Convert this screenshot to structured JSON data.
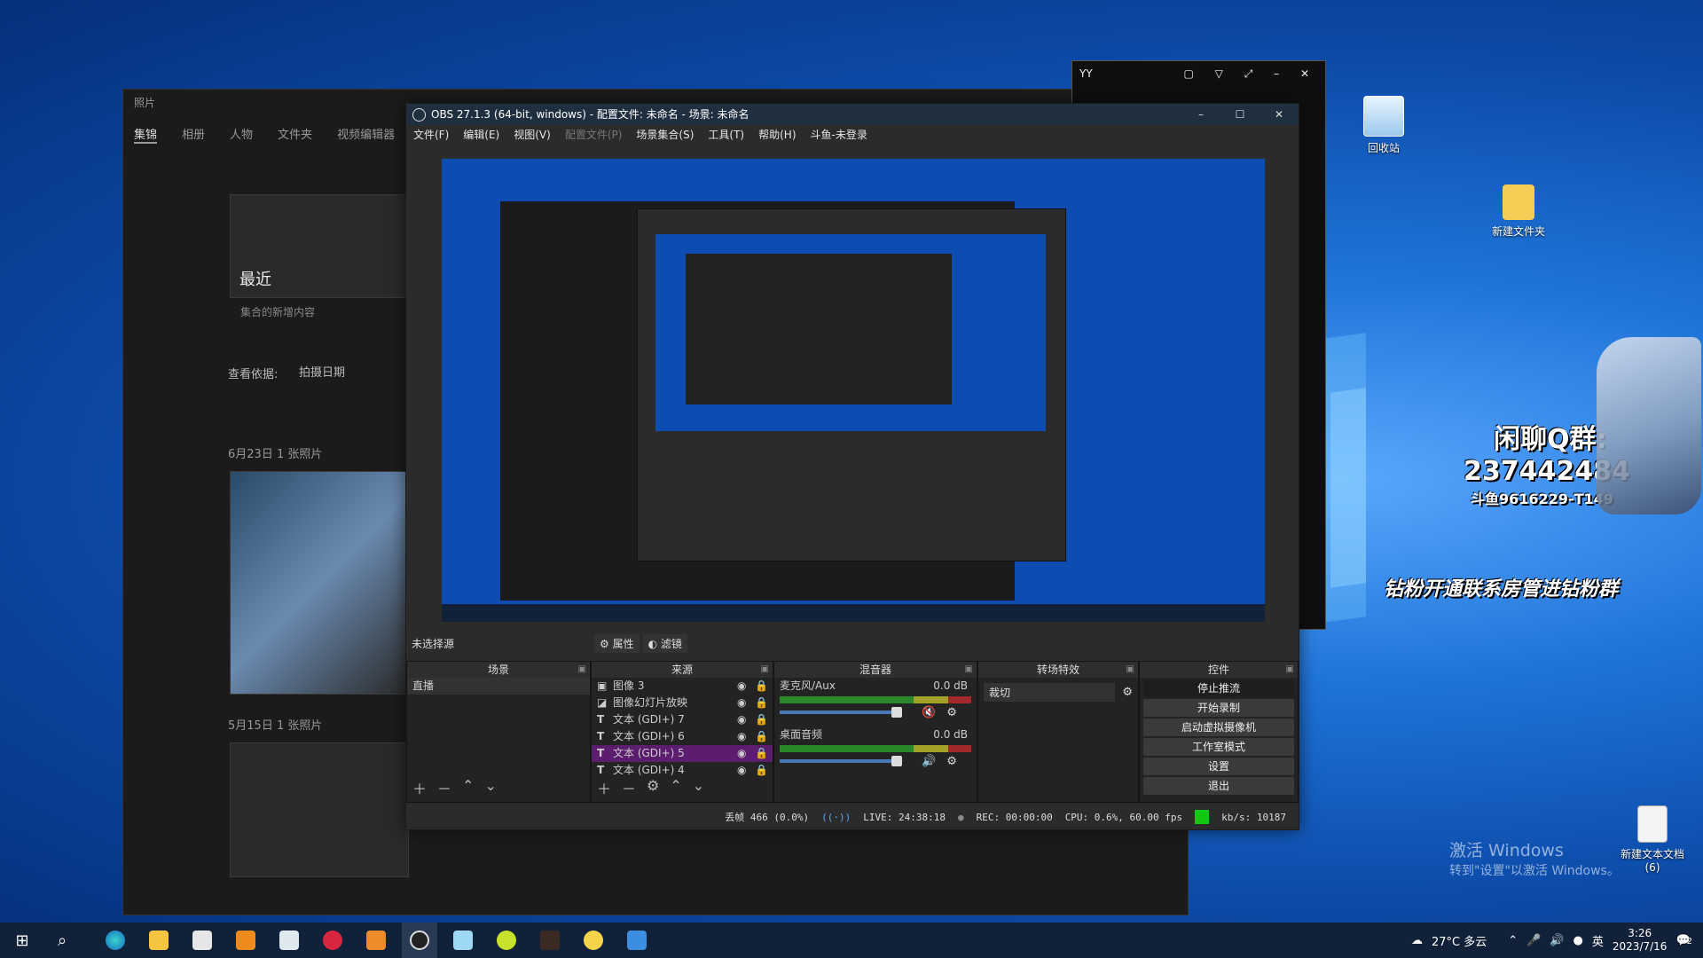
{
  "desktop": {
    "icons": [
      {
        "label": "回收站",
        "icon": "recycle-bin-icon"
      },
      {
        "label": "新建文件夹",
        "icon": "folder-icon"
      },
      {
        "label": "新建文本文档\n(6)",
        "icon": "text-file-icon"
      }
    ],
    "overlay": {
      "qq_group_label": "闲聊Q群:",
      "qq_group_number": "237442484",
      "douyu_id": "斗鱼9616229-T149",
      "banner": "钻粉开通联系房管进钻粉群"
    },
    "watermark": {
      "line1": "激活 Windows",
      "line2": "转到\"设置\"以激活 Windows。"
    }
  },
  "photos_app": {
    "title": "照片",
    "tabs": [
      "集锦",
      "相册",
      "人物",
      "文件夹",
      "视频编辑器"
    ],
    "recent": "最近",
    "recent_sub": "集合的新增内容",
    "sort_label": "查看依据:",
    "sort_value": "拍摄日期",
    "group1": "6月23日   1 张照片",
    "group2": "5月15日   1 张照片"
  },
  "yy_window": {
    "title": "YY"
  },
  "obs": {
    "title": "OBS 27.1.3 (64-bit, windows) - 配置文件: 未命名 - 场景: 未命名",
    "menu": [
      "文件(F)",
      "编辑(E)",
      "视图(V)",
      "配置文件(P)",
      "场景集合(S)",
      "工具(T)",
      "帮助(H)",
      "斗鱼-未登录"
    ],
    "no_source": "未选择源",
    "properties_btn": "属性",
    "filters_btn": "滤镜",
    "docks": {
      "scenes": {
        "title": "场景",
        "items": [
          "直播"
        ]
      },
      "sources": {
        "title": "来源",
        "items": [
          "图像 3",
          "图像幻灯片放映",
          "文本 (GDI+) 7",
          "文本 (GDI+) 6",
          "文本 (GDI+) 5",
          "文本 (GDI+) 4"
        ],
        "selected_index": 4
      },
      "mixer": {
        "title": "混音器",
        "channels": [
          {
            "name": "麦克风/Aux",
            "db": "0.0 dB"
          },
          {
            "name": "桌面音频",
            "db": "0.0 dB"
          }
        ]
      },
      "transitions": {
        "title": "转场特效",
        "value": "裁切"
      },
      "controls": {
        "title": "控件",
        "buttons": [
          "停止推流",
          "开始录制",
          "启动虚拟摄像机",
          "工作室模式",
          "设置",
          "退出"
        ]
      }
    },
    "status": {
      "dropped": "丢帧 466 (0.0%)",
      "live": "LIVE: 24:38:18",
      "rec": "REC: 00:00:00",
      "cpu": "CPU: 0.6%, 60.00 fps",
      "kbps": "kb/s: 10187"
    }
  },
  "taskbar": {
    "weather": "27°C 多云",
    "ime": "英",
    "time": "3:26",
    "date": "2023/7/16",
    "notif_count": "2"
  },
  "colors": {
    "obs_selected": "#5c1d6e",
    "live_green": "#12c912"
  }
}
